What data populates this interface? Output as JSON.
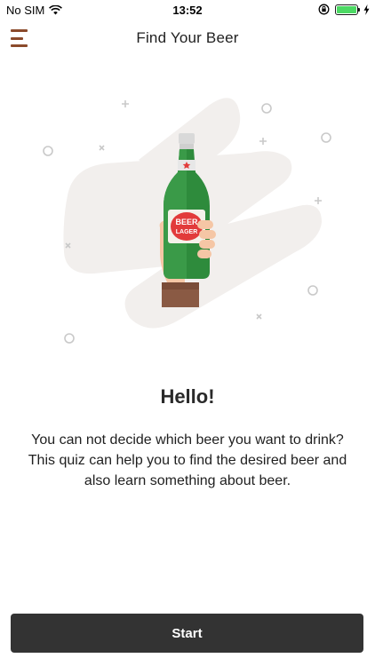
{
  "status_bar": {
    "carrier": "No SIM",
    "time": "13:52",
    "wifi_icon": "wifi-icon",
    "lock_icon": "orientation-lock-icon",
    "battery_icon": "battery-icon",
    "charging_icon": "charging-bolt-icon",
    "battery_level": 1.0
  },
  "nav": {
    "title": "Find Your Beer",
    "menu_icon": "hamburger-menu-icon"
  },
  "illustration": {
    "label_top": "BEER",
    "label_bottom": "LAGER"
  },
  "main": {
    "heading": "Hello!",
    "description_line1": "You can not decide which beer you want to drink?",
    "description_line2": "This quiz can help you to find the desired beer and also learn something about beer."
  },
  "footer": {
    "start_label": "Start"
  },
  "colors": {
    "accent": "#8b4a2b",
    "button_bg": "#333333",
    "bottle_green": "#2e8b3c",
    "blob": "#f2efed"
  }
}
